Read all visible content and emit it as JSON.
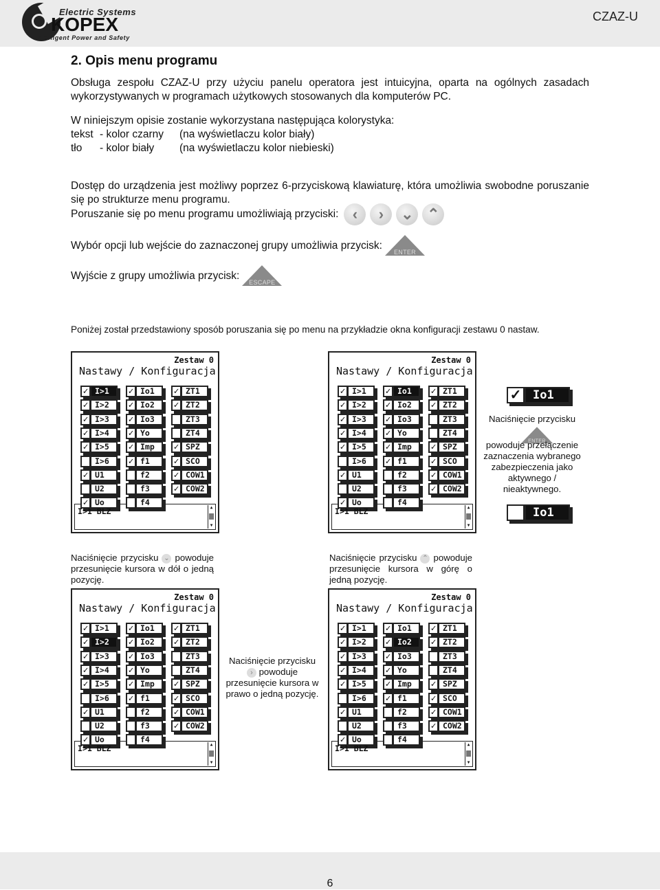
{
  "header": {
    "logo": {
      "top_text": "Electric Systems",
      "brand": "KOPEX",
      "tagline": "Intelligent Power and Safety"
    },
    "doc_code": "CZAZ-U"
  },
  "section_title": "2. Opis menu programu",
  "intro": "Obsługa zespołu CZAZ-U przy użyciu panelu operatora jest intuicyjna, oparta na ogólnych zasadach wykorzystywanych w programach użytkowych stosowanych dla komputerów PC.",
  "colors_intro": "W niniejszym opisie zostanie wykorzystana następująca kolorystyka:",
  "color_rows": [
    {
      "name": "tekst",
      "doc": "- kolor czarny",
      "display": "(na wyświetlaczu kolor biały)"
    },
    {
      "name": "tło",
      "doc": "- kolor biały",
      "display": "(na wyświetlaczu kolor niebieski)"
    }
  ],
  "access_text": "Dostęp do urządzenia jest możliwy poprzez 6-przyciskową klawiaturę, która umożliwia swobodne poruszanie się po strukturze menu programu.",
  "nav_line": "Poruszanie się po menu programu umożliwiają przyciski:",
  "nav_buttons": [
    {
      "icon": "chevron-left-icon",
      "glyph": "‹"
    },
    {
      "icon": "chevron-right-icon",
      "glyph": "›"
    },
    {
      "icon": "chevron-down-icon",
      "glyph": "⌄"
    },
    {
      "icon": "chevron-up-icon",
      "glyph": "⌃"
    }
  ],
  "enter_line": "Wybór opcji lub wejście do zaznaczonej grupy umożliwia przycisk:",
  "enter_label": "ENTER",
  "escape_line": "Wyjście z grupy umożliwia przycisk:",
  "escape_label": "ESCAPE",
  "example_intro": "Poniżej został przedstawiony sposób poruszania się po menu na przykładzie okna konfiguracji zestawu 0 nastaw.",
  "panel_common": {
    "zestaw": "Zestaw 0",
    "title": "Nastawy / Konfiguracja",
    "message": "I>1 BLZ",
    "check_glyph": "✓",
    "columns": [
      [
        {
          "label": "I>1",
          "checked": true
        },
        {
          "label": "I>2",
          "checked": true
        },
        {
          "label": "I>3",
          "checked": true
        },
        {
          "label": "I>4",
          "checked": true
        },
        {
          "label": "I>5",
          "checked": true
        },
        {
          "label": "I>6",
          "checked": false
        },
        {
          "label": "U1",
          "checked": true
        },
        {
          "label": "U2",
          "checked": false
        },
        {
          "label": "Uo",
          "checked": true
        }
      ],
      [
        {
          "label": "Io1",
          "checked": true
        },
        {
          "label": "Io2",
          "checked": true
        },
        {
          "label": "Io3",
          "checked": true
        },
        {
          "label": "Yo",
          "checked": true
        },
        {
          "label": "Imp",
          "checked": true
        },
        {
          "label": "f1",
          "checked": true
        },
        {
          "label": "f2",
          "checked": false
        },
        {
          "label": "f3",
          "checked": false
        },
        {
          "label": "f4",
          "checked": false
        }
      ],
      [
        {
          "label": "ZT1",
          "checked": true
        },
        {
          "label": "ZT2",
          "checked": true
        },
        {
          "label": "ZT3",
          "checked": false
        },
        {
          "label": "ZT4",
          "checked": false
        },
        {
          "label": "SPZ",
          "checked": true
        },
        {
          "label": "SCO",
          "checked": true
        },
        {
          "label": "COW1",
          "checked": true
        },
        {
          "label": "COW2",
          "checked": true
        }
      ]
    ]
  },
  "panels": [
    {
      "selected": "I>1"
    },
    {
      "selected": "Io1"
    },
    {
      "selected": "I>2"
    },
    {
      "selected": "Io2"
    }
  ],
  "enter_note": {
    "before": {
      "label": "Io1",
      "checked": true
    },
    "line1": "Naciśnięcie przycisku",
    "line2": "powoduje przełączenie zaznaczenia wybranego zabezpieczenia jako aktywnego / nieaktywnego.",
    "after": {
      "label": "Io1",
      "checked": false
    }
  },
  "down_note": {
    "pre": "Naciśnięcie przycisku",
    "post": "powoduje przesunięcie kursora w dół o jedną pozycję."
  },
  "up_note": {
    "pre": "Naciśnięcie przycisku",
    "post": "powoduje przesunięcie kursora w górę o jedną pozycję."
  },
  "right_note": {
    "pre": "Naciśnięcie przycisku",
    "post": "powoduje przesunięcie kursora w prawo o jedną pozycję."
  },
  "page_number": "6"
}
